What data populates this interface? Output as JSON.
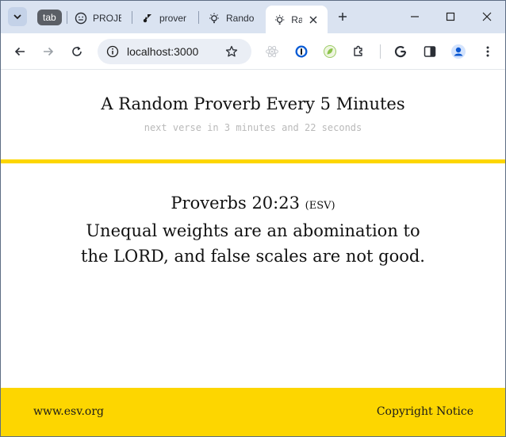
{
  "browser": {
    "tab_group_label": "tab",
    "tabs": [
      {
        "label": "PROJECT",
        "icon": "smiley-icon"
      },
      {
        "label": "proverbs",
        "icon": "vercel-icon"
      },
      {
        "label": "Random",
        "icon": "lightbulb-icon"
      },
      {
        "label": "Ra",
        "icon": "lightbulb-icon",
        "active": true
      }
    ],
    "address": "localhost:3000",
    "accent": "#dae3f1"
  },
  "page": {
    "title": "A Random Proverb Every 5 Minutes",
    "countdown": "next verse in 3 minutes and 22 seconds",
    "verse": {
      "reference": "Proverbs 20:23",
      "version": "(ESV)",
      "text": "Unequal weights are an abomination to the LORD, and false scales are not good."
    },
    "footer": {
      "left_link": "www.esv.org",
      "right_link": "Copyright Notice"
    },
    "accent_color": "#fdd600"
  }
}
